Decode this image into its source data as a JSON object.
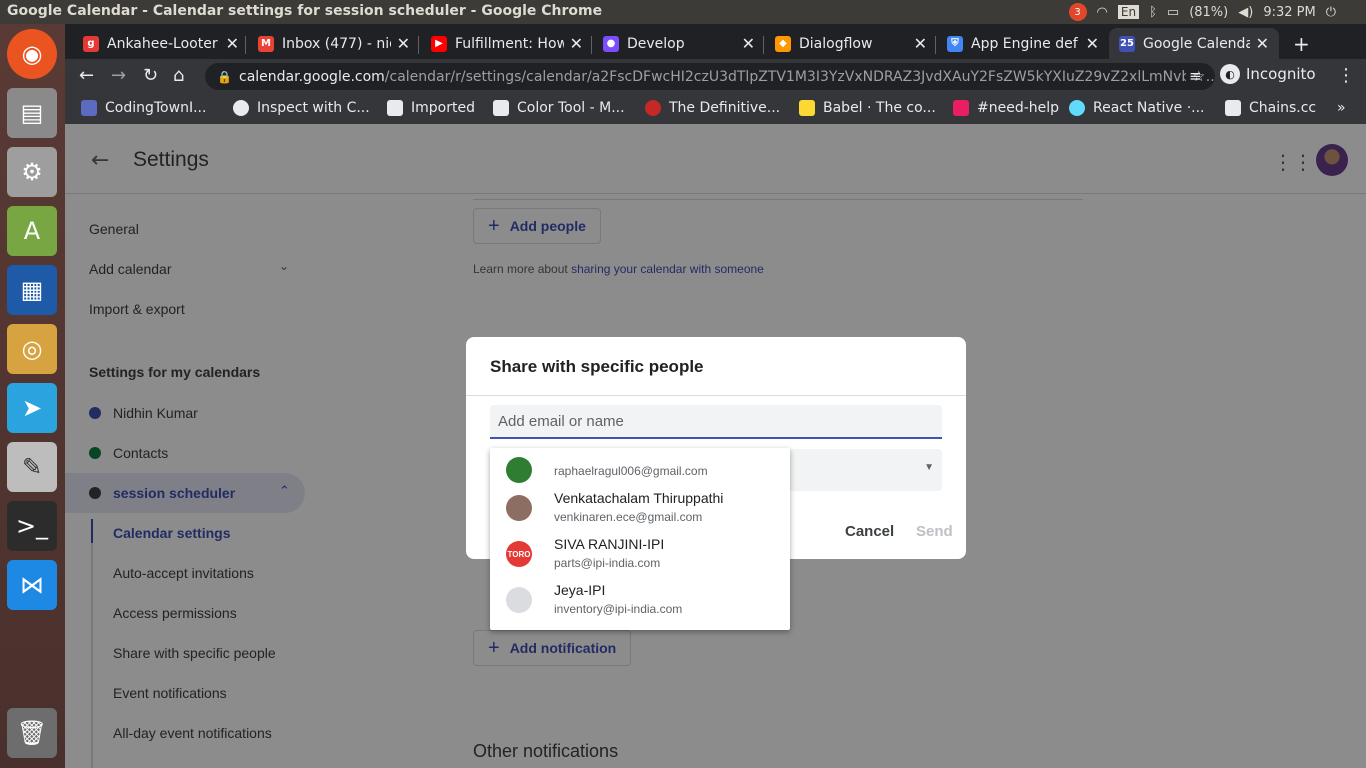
{
  "os": {
    "window_title": "Google Calendar - Calendar settings for session scheduler - Google Chrome",
    "tray": {
      "notif_count": "3",
      "lang": "En",
      "battery": "(81%)",
      "time": "9:32 PM"
    },
    "launcher": [
      "ubuntu-icon",
      "files-icon",
      "settings-icon",
      "android-studio-icon",
      "writer-icon",
      "chrome-icon",
      "telegram-icon",
      "text-editor-icon",
      "terminal-icon",
      "vscode-icon",
      "trash-icon"
    ]
  },
  "browser": {
    "tabs": [
      {
        "label": "Ankahee-Looter",
        "color": "#e53935",
        "glyph": "g"
      },
      {
        "label": "Inbox (477) - nid",
        "color": "#ea4335",
        "glyph": "M"
      },
      {
        "label": "Fulfillment: How",
        "color": "#ff0000",
        "glyph": "▶"
      },
      {
        "label": "Develop",
        "color": "#7c4dff",
        "glyph": "●"
      },
      {
        "label": "Dialogflow",
        "color": "#ff9800",
        "glyph": "◆"
      },
      {
        "label": "App Engine def",
        "color": "#4285f4",
        "glyph": "⛨"
      },
      {
        "label": "Google Calenda",
        "color": "#3f51b5",
        "glyph": "25"
      }
    ],
    "new_tab": "+",
    "url_domain": "calendar.google.com",
    "url_path": "/calendar/r/settings/calendar/a2FscDFwcHI2czU3dTlpZTV1M3I3YzVxNDRAZ3JvdXAuY2FsZW5kYXIuZ29vZ2xlLmNvbQ...",
    "incognito_label": "Incognito",
    "bookmarks": [
      {
        "label": "CodingTownI...",
        "color": "#5c6bc0"
      },
      {
        "label": "Inspect with C...",
        "color": "#ffffff"
      },
      {
        "label": "Imported",
        "color": "#e8eaed"
      },
      {
        "label": "Color Tool - M...",
        "color": "#ffffff"
      },
      {
        "label": "The Definitive...",
        "color": "#c62828"
      },
      {
        "label": "Babel · The co...",
        "color": "#fdd835"
      },
      {
        "label": "#need-help",
        "color": "#e91e63"
      },
      {
        "label": "React Native ·...",
        "color": "#61dafb"
      },
      {
        "label": "Chains.cc",
        "color": "#ffffff"
      }
    ],
    "more_bookmarks": "»"
  },
  "page": {
    "title": "Settings",
    "nav": {
      "general": "General",
      "add_calendar": "Add calendar",
      "import_export": "Import & export",
      "my_calendars_heading": "Settings for my calendars",
      "calendars": [
        {
          "label": "Nidhin Kumar",
          "color": "#3f51b5"
        },
        {
          "label": "Contacts",
          "color": "#0b8043"
        },
        {
          "label": "session scheduler",
          "color": "#3c4043"
        }
      ],
      "sub_items": [
        "Calendar settings",
        "Auto-accept invitations",
        "Access permissions",
        "Share with specific people",
        "Event notifications",
        "All-day event notifications"
      ]
    },
    "content": {
      "add_people": "Add people",
      "learn_more_prefix": "Learn more about ",
      "learn_more_link": "sharing your calendar with someone",
      "add_notification": "Add notification",
      "other_notifications": "Other notifications"
    }
  },
  "dialog": {
    "title": "Share with specific people",
    "input_placeholder": "Add email or name",
    "cancel": "Cancel",
    "send": "Send",
    "suggestions": [
      {
        "name": "",
        "email": "raphaelragul006@gmail.com",
        "avatar_color": "#2e7d32"
      },
      {
        "name": "Venkatachalam Thiruppathi",
        "email": "venkinaren.ece@gmail.com",
        "avatar_color": "#8d6e63"
      },
      {
        "name": "SIVA RANJINI-IPI",
        "email": "parts@ipi-india.com",
        "avatar_color": "#e53935",
        "avatar_text": "TORO"
      },
      {
        "name": "Jeya-IPI",
        "email": "inventory@ipi-india.com",
        "avatar_color": "#dadce0"
      }
    ]
  }
}
